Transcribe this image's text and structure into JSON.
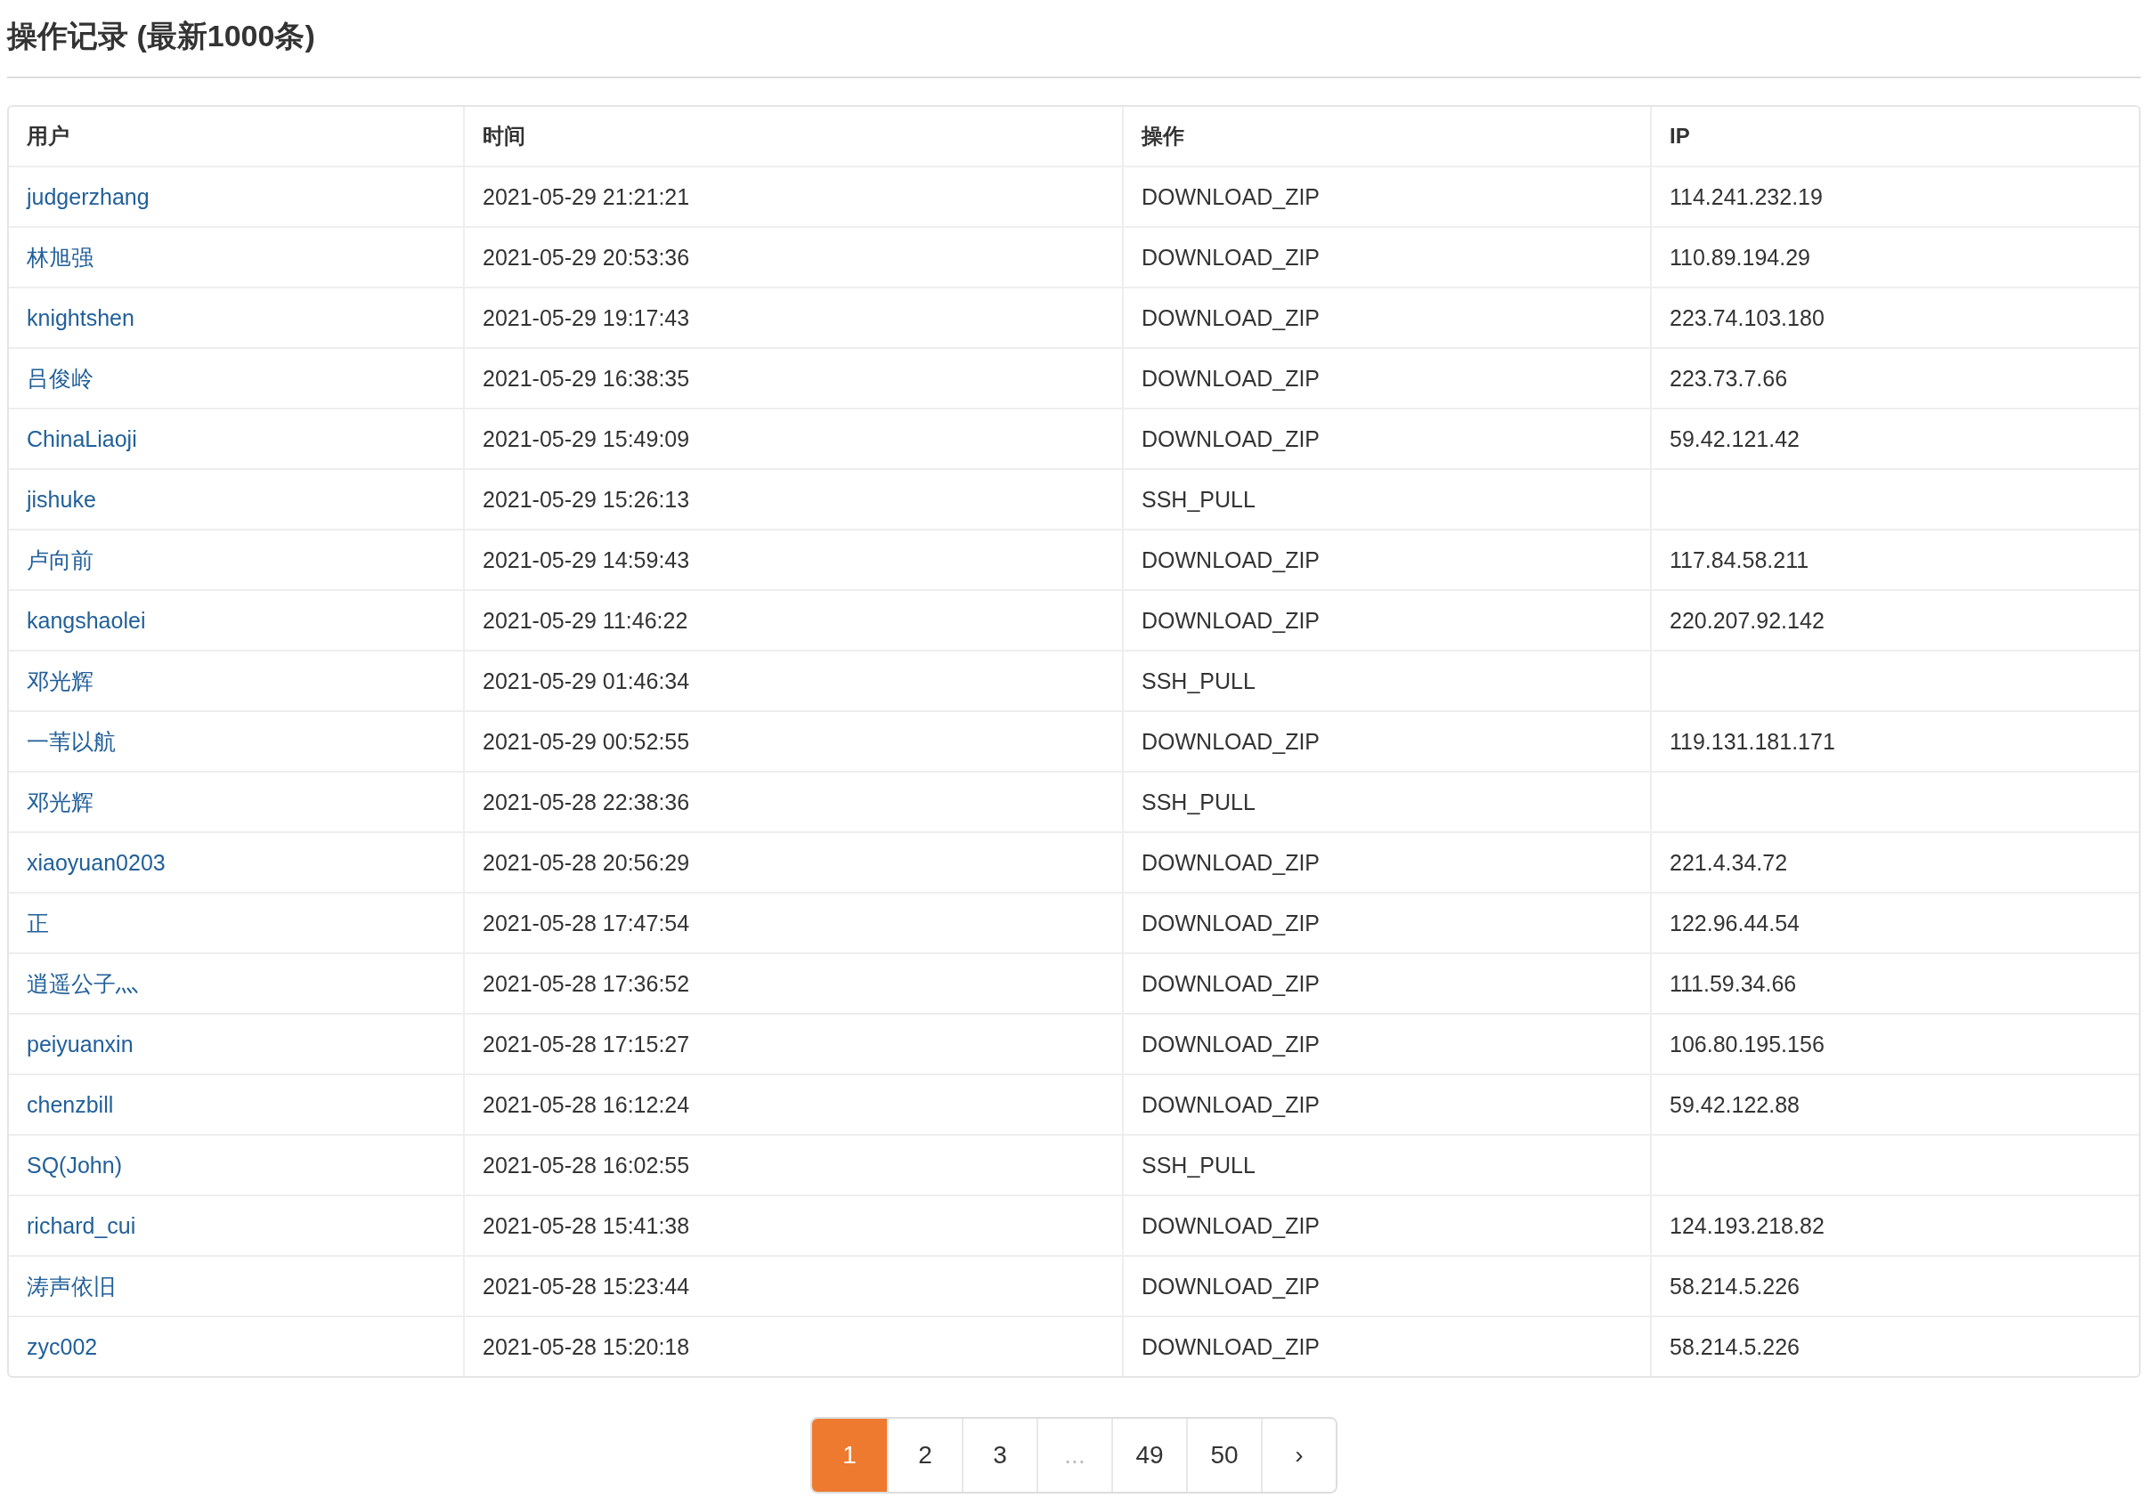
{
  "title": "操作记录 (最新1000条)",
  "table": {
    "columns": [
      "用户",
      "时间",
      "操作",
      "IP"
    ],
    "rows": [
      {
        "user": "judgerzhang",
        "time": "2021-05-29 21:21:21",
        "action": "DOWNLOAD_ZIP",
        "ip": "114.241.232.19"
      },
      {
        "user": "林旭强",
        "time": "2021-05-29 20:53:36",
        "action": "DOWNLOAD_ZIP",
        "ip": "110.89.194.29"
      },
      {
        "user": "knightshen",
        "time": "2021-05-29 19:17:43",
        "action": "DOWNLOAD_ZIP",
        "ip": "223.74.103.180"
      },
      {
        "user": "吕俊岭",
        "time": "2021-05-29 16:38:35",
        "action": "DOWNLOAD_ZIP",
        "ip": "223.73.7.66"
      },
      {
        "user": "ChinaLiaoji",
        "time": "2021-05-29 15:49:09",
        "action": "DOWNLOAD_ZIP",
        "ip": "59.42.121.42"
      },
      {
        "user": "jishuke",
        "time": "2021-05-29 15:26:13",
        "action": "SSH_PULL"
      },
      {
        "user": "卢向前",
        "time": "2021-05-29 14:59:43",
        "action": "DOWNLOAD_ZIP",
        "ip": "117.84.58.211"
      },
      {
        "user": "kangshaolei",
        "time": "2021-05-29 11:46:22",
        "action": "DOWNLOAD_ZIP",
        "ip": "220.207.92.142"
      },
      {
        "user": "邓光辉",
        "time": "2021-05-29 01:46:34",
        "action": "SSH_PULL"
      },
      {
        "user": "一苇以航",
        "time": "2021-05-29 00:52:55",
        "action": "DOWNLOAD_ZIP",
        "ip": "119.131.181.171"
      },
      {
        "user": "邓光辉",
        "time": "2021-05-28 22:38:36",
        "action": "SSH_PULL"
      },
      {
        "user": "xiaoyuan0203",
        "time": "2021-05-28 20:56:29",
        "action": "DOWNLOAD_ZIP",
        "ip": "221.4.34.72"
      },
      {
        "user": "正",
        "time": "2021-05-28 17:47:54",
        "action": "DOWNLOAD_ZIP",
        "ip": "122.96.44.54"
      },
      {
        "user": "逍遥公子灬",
        "time": "2021-05-28 17:36:52",
        "action": "DOWNLOAD_ZIP",
        "ip": "111.59.34.66"
      },
      {
        "user": "peiyuanxin",
        "time": "2021-05-28 17:15:27",
        "action": "DOWNLOAD_ZIP",
        "ip": "106.80.195.156"
      },
      {
        "user": "chenzbill",
        "time": "2021-05-28 16:12:24",
        "action": "DOWNLOAD_ZIP",
        "ip": "59.42.122.88"
      },
      {
        "user": "SQ(John)",
        "time": "2021-05-28 16:02:55",
        "action": "SSH_PULL"
      },
      {
        "user": "richard_cui",
        "time": "2021-05-28 15:41:38",
        "action": "DOWNLOAD_ZIP",
        "ip": "124.193.218.82"
      },
      {
        "user": "涛声依旧",
        "time": "2021-05-28 15:23:44",
        "action": "DOWNLOAD_ZIP",
        "ip": "58.214.5.226"
      },
      {
        "user": "zyc002",
        "time": "2021-05-28 15:20:18",
        "action": "DOWNLOAD_ZIP",
        "ip": "58.214.5.226"
      }
    ]
  },
  "pagination": [
    {
      "kind": "page",
      "label": "1",
      "selected": true
    },
    {
      "kind": "page",
      "label": "2",
      "selected": false
    },
    {
      "kind": "page",
      "label": "3",
      "selected": false
    },
    {
      "kind": "ellipsis",
      "label": "..."
    },
    {
      "kind": "page",
      "label": "49",
      "selected": false
    },
    {
      "kind": "page",
      "label": "50",
      "selected": false
    },
    {
      "kind": "next",
      "label": "›",
      "selected": false
    }
  ]
}
